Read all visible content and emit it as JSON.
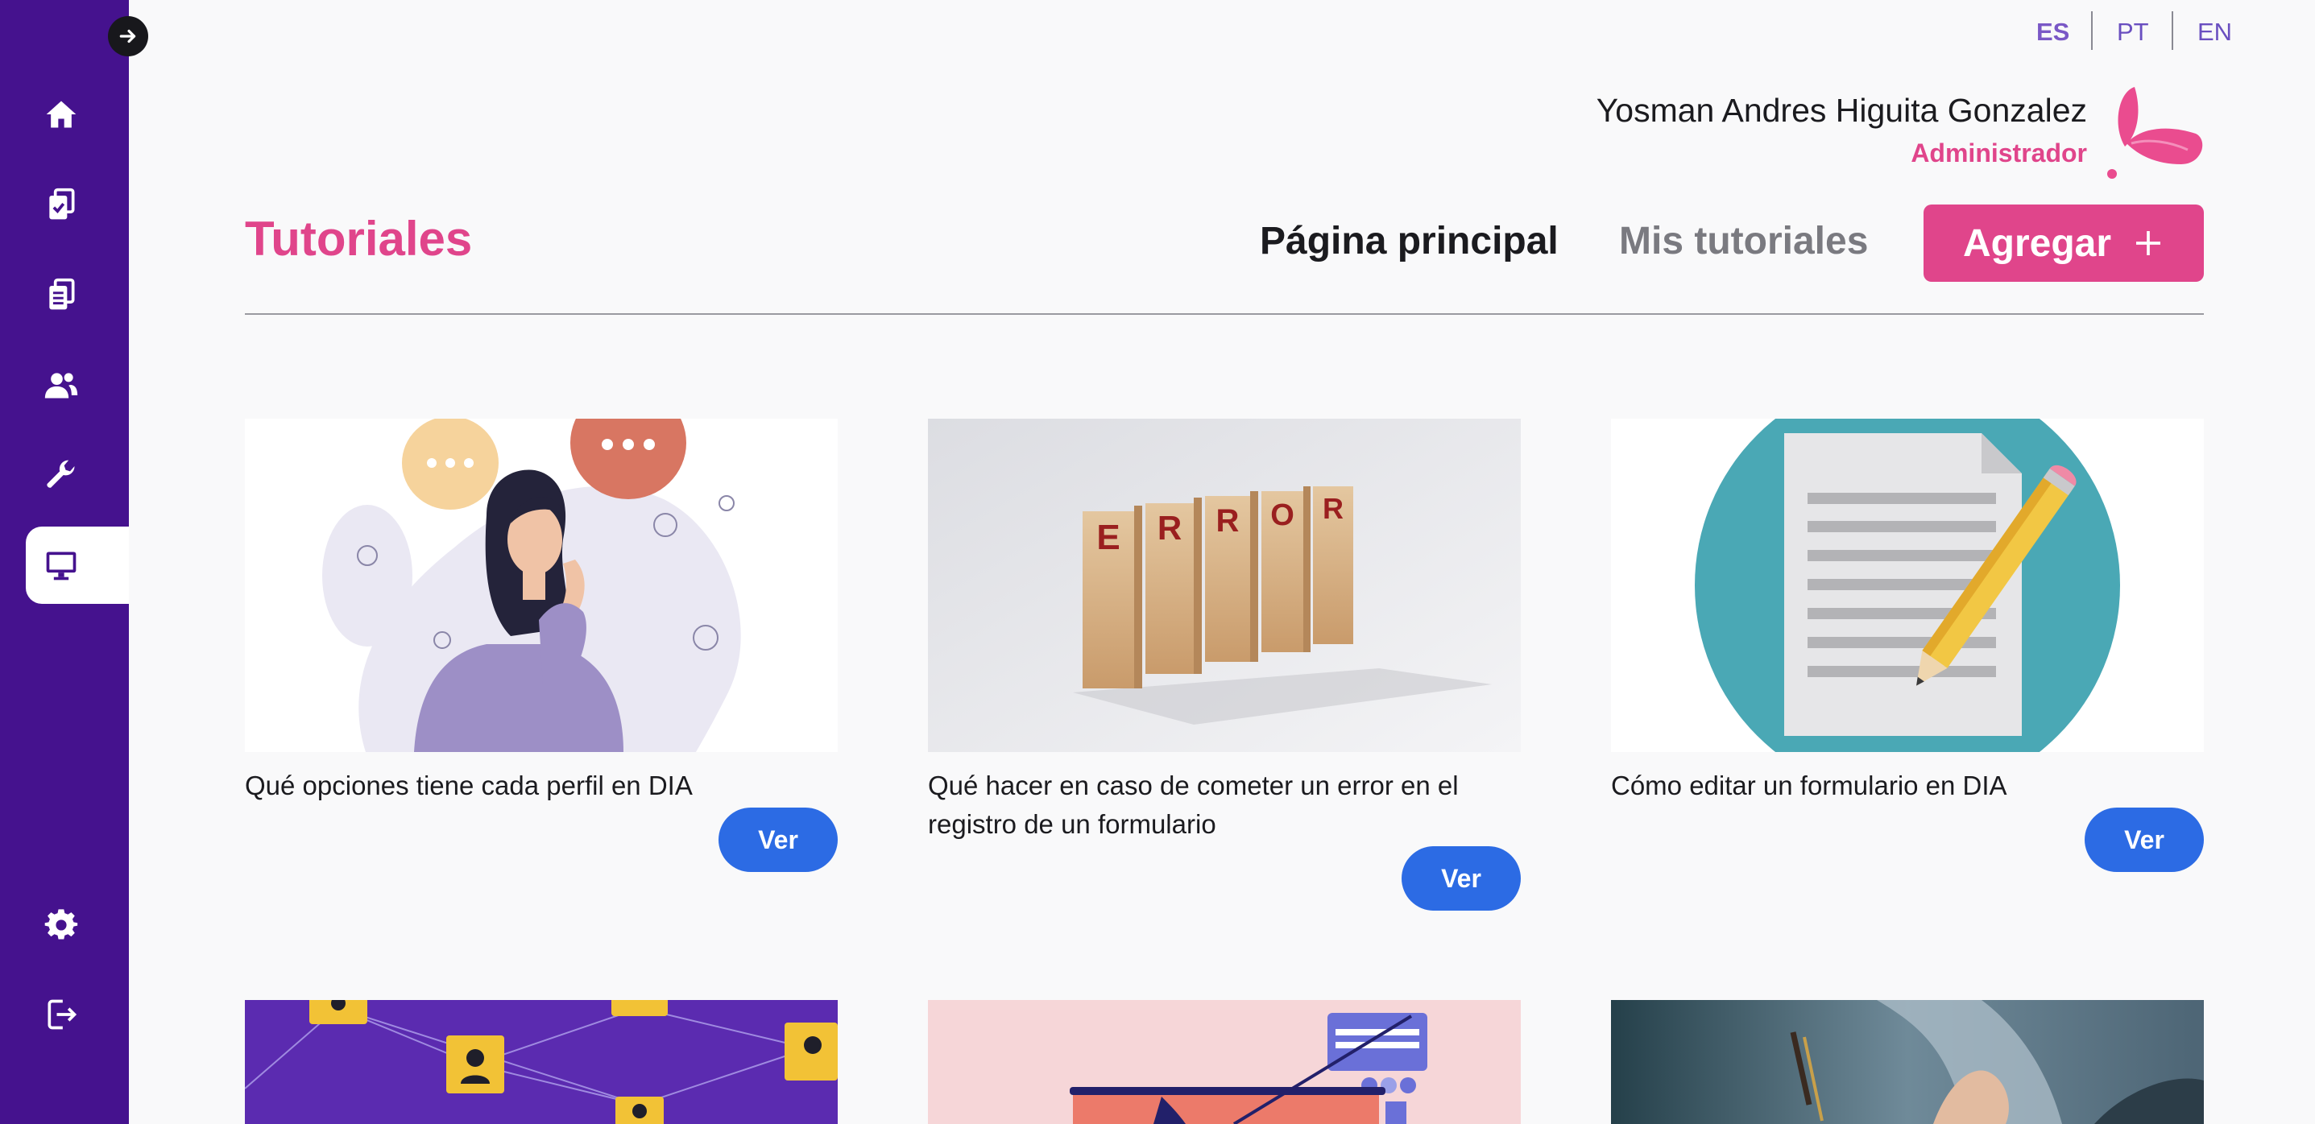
{
  "sidebar": {
    "items": [
      {
        "name": "home-icon"
      },
      {
        "name": "checked-forms-icon"
      },
      {
        "name": "forms-icon"
      },
      {
        "name": "users-icon"
      },
      {
        "name": "wrench-icon"
      },
      {
        "name": "monitor-icon",
        "active": true
      }
    ],
    "bottom_items": [
      {
        "name": "gear-icon"
      },
      {
        "name": "logout-icon"
      }
    ]
  },
  "languages": [
    {
      "code": "ES",
      "active": true
    },
    {
      "code": "PT",
      "active": false
    },
    {
      "code": "EN",
      "active": false
    }
  ],
  "user": {
    "name": "Yosman Andres Higuita Gonzalez",
    "role": "Administrador"
  },
  "header": {
    "title": "Tutoriales",
    "tabs": [
      {
        "label": "Página principal",
        "active": true
      },
      {
        "label": "Mis tutoriales",
        "active": false
      }
    ],
    "add_label": "Agregar",
    "add_icon": "plus-icon"
  },
  "tutorials": [
    {
      "title": "Qué opciones tiene cada perfil en DIA",
      "button": "Ver",
      "image": "thinking-woman-illustration"
    },
    {
      "title": "Qué hacer en caso de cometer un error en el registro de un formulario",
      "button": "Ver",
      "image": "error-wooden-blocks-photo"
    },
    {
      "title": "Cómo editar un formulario en DIA",
      "button": "Ver",
      "image": "document-pencil-illustration"
    },
    {
      "title": "",
      "button": "",
      "image": "network-profiles-illustration"
    },
    {
      "title": "",
      "button": "",
      "image": "laptop-ui-illustration"
    },
    {
      "title": "",
      "button": "",
      "image": "hand-writing-photo"
    }
  ],
  "colors": {
    "sidebar": "#45128e",
    "accent": "#e0458b",
    "button_blue": "#2c6be4"
  }
}
